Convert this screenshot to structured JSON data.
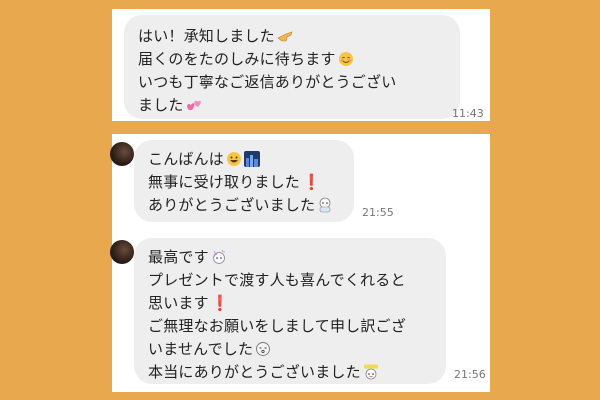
{
  "messages": [
    {
      "lines": [
        "はい！承知しました",
        "届くのをたのしみに待ちます",
        "いつも丁寧なご返信ありがとうござい",
        "ました"
      ],
      "time": "11:43",
      "icons": [
        "pointing-hand-icon",
        "smiling-face-icon",
        "pink-hearts-icon"
      ]
    },
    {
      "lines": [
        "こんばんは",
        "無事に受け取りました",
        "ありがとうございました"
      ],
      "time": "21:55",
      "icons": [
        "grinning-face-icon",
        "night-city-icon",
        "red-exclamation-icon",
        "bow-sticker-icon"
      ]
    },
    {
      "lines": [
        "最高です",
        "プレゼントで渡す人も喜んでくれると",
        "思います",
        "ご無理なお願いをしまして申し訳ござ",
        "いませんでした",
        "本当にありがとうございました"
      ],
      "time": "21:56",
      "icons": [
        "sparkle-sticker-icon",
        "red-exclamation-icon",
        "sorry-face-icon",
        "thanks-sticker-icon"
      ]
    }
  ],
  "colors": {
    "background": "#e8a94e",
    "bubble": "#eeeeee",
    "exclamation": "#d62020"
  }
}
